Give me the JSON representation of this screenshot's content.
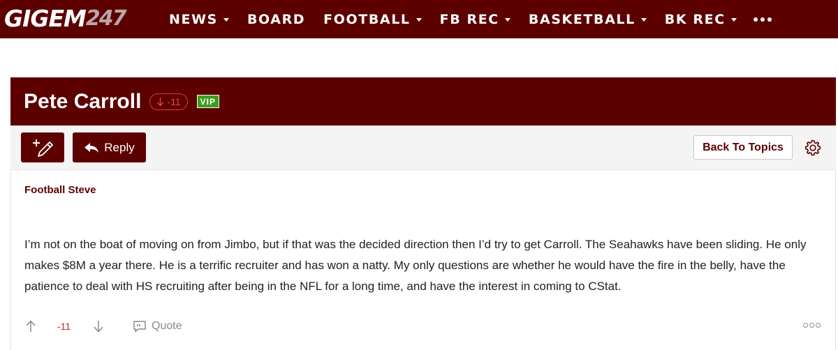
{
  "topnav": {
    "logo_main": "GIGEM",
    "logo_num": "247",
    "items": [
      {
        "label": "NEWS",
        "has_caret": true
      },
      {
        "label": "BOARD",
        "has_caret": false
      },
      {
        "label": "FOOTBALL",
        "has_caret": true
      },
      {
        "label": "FB REC",
        "has_caret": true
      },
      {
        "label": "BASKETBALL",
        "has_caret": true
      },
      {
        "label": "BK REC",
        "has_caret": true
      }
    ],
    "more_icon": "ellipsis-icon"
  },
  "thread": {
    "title": "Pete Carroll",
    "vote_score": "-11",
    "vip_label": "VIP"
  },
  "toolbar": {
    "reply_label": "Reply",
    "back_label": "Back To Topics",
    "new_post_icon": "pencil-plus-icon",
    "settings_icon": "gear-icon"
  },
  "post": {
    "author": "Football Steve",
    "body": "I’m not on the boat of moving on from Jimbo, but if that was the decided direction then I’d try to get Carroll. The Seahawks have been sliding. He only makes $8M a year there. He is a terrific recruiter and has won a natty. My only questions are whether he would have the fire in the belly, have the patience to deal with HS recruiting after being in the NFL for a long time, and have the interest in coming to CStat.",
    "score": "-11",
    "quote_label": "Quote"
  },
  "colors": {
    "brand": "#5c0000",
    "negative": "#d42020",
    "vip": "#3f9c1e"
  }
}
